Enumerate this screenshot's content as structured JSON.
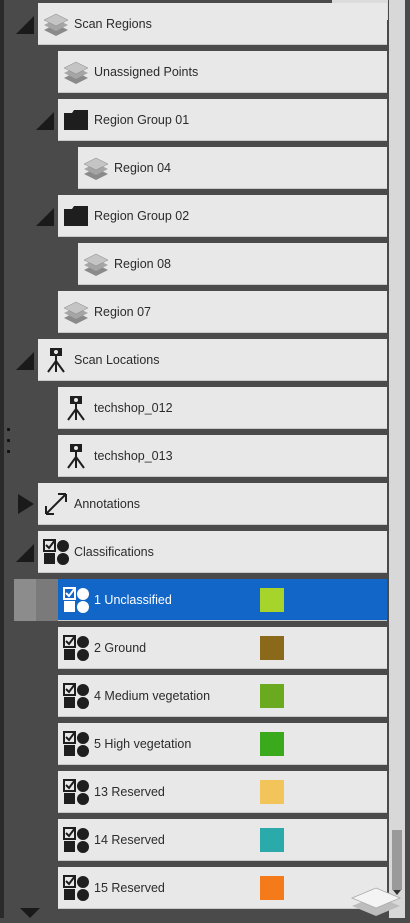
{
  "tree": {
    "scan_regions": {
      "label": "Scan Regions",
      "icon": "layers-icon",
      "children": {
        "unassigned": {
          "label": "Unassigned Points",
          "icon": "layers-icon"
        },
        "group01": {
          "label": "Region Group 01",
          "icon": "folder-icon",
          "children": [
            {
              "label": "Region 04",
              "icon": "layers-icon"
            }
          ]
        },
        "group02": {
          "label": "Region Group 02",
          "icon": "folder-icon",
          "children": [
            {
              "label": "Region 08",
              "icon": "layers-icon"
            }
          ]
        },
        "region07": {
          "label": "Region 07",
          "icon": "layers-icon"
        }
      }
    },
    "scan_locations": {
      "label": "Scan Locations",
      "icon": "scanner-tripod-icon",
      "children": [
        {
          "label": "techshop_012",
          "icon": "scanner-tripod-icon"
        },
        {
          "label": "techshop_013",
          "icon": "scanner-tripod-icon"
        }
      ]
    },
    "annotations": {
      "label": "Annotations",
      "icon": "measure-arrow-icon",
      "expanded": false
    },
    "classifications": {
      "label": "Classifications",
      "icon": "classification-shapes-icon",
      "expanded": true,
      "items": [
        {
          "label": "1 Unclassified",
          "color": "#a6d42a",
          "selected": true
        },
        {
          "label": "2 Ground",
          "color": "#8a6a1a"
        },
        {
          "label": "4 Medium vegetation",
          "color": "#6aaa1e"
        },
        {
          "label": "5 High vegetation",
          "color": "#3aaa1c"
        },
        {
          "label": "13 Reserved",
          "color": "#f2c45a"
        },
        {
          "label": "14 Reserved",
          "color": "#2aaaaa"
        },
        {
          "label": "15 Reserved",
          "color": "#f47a1a"
        }
      ]
    }
  },
  "colors": {
    "selection": "#1166c8",
    "row_bg": "#e8e8e8",
    "panel_bg": "#4a4a4a"
  }
}
